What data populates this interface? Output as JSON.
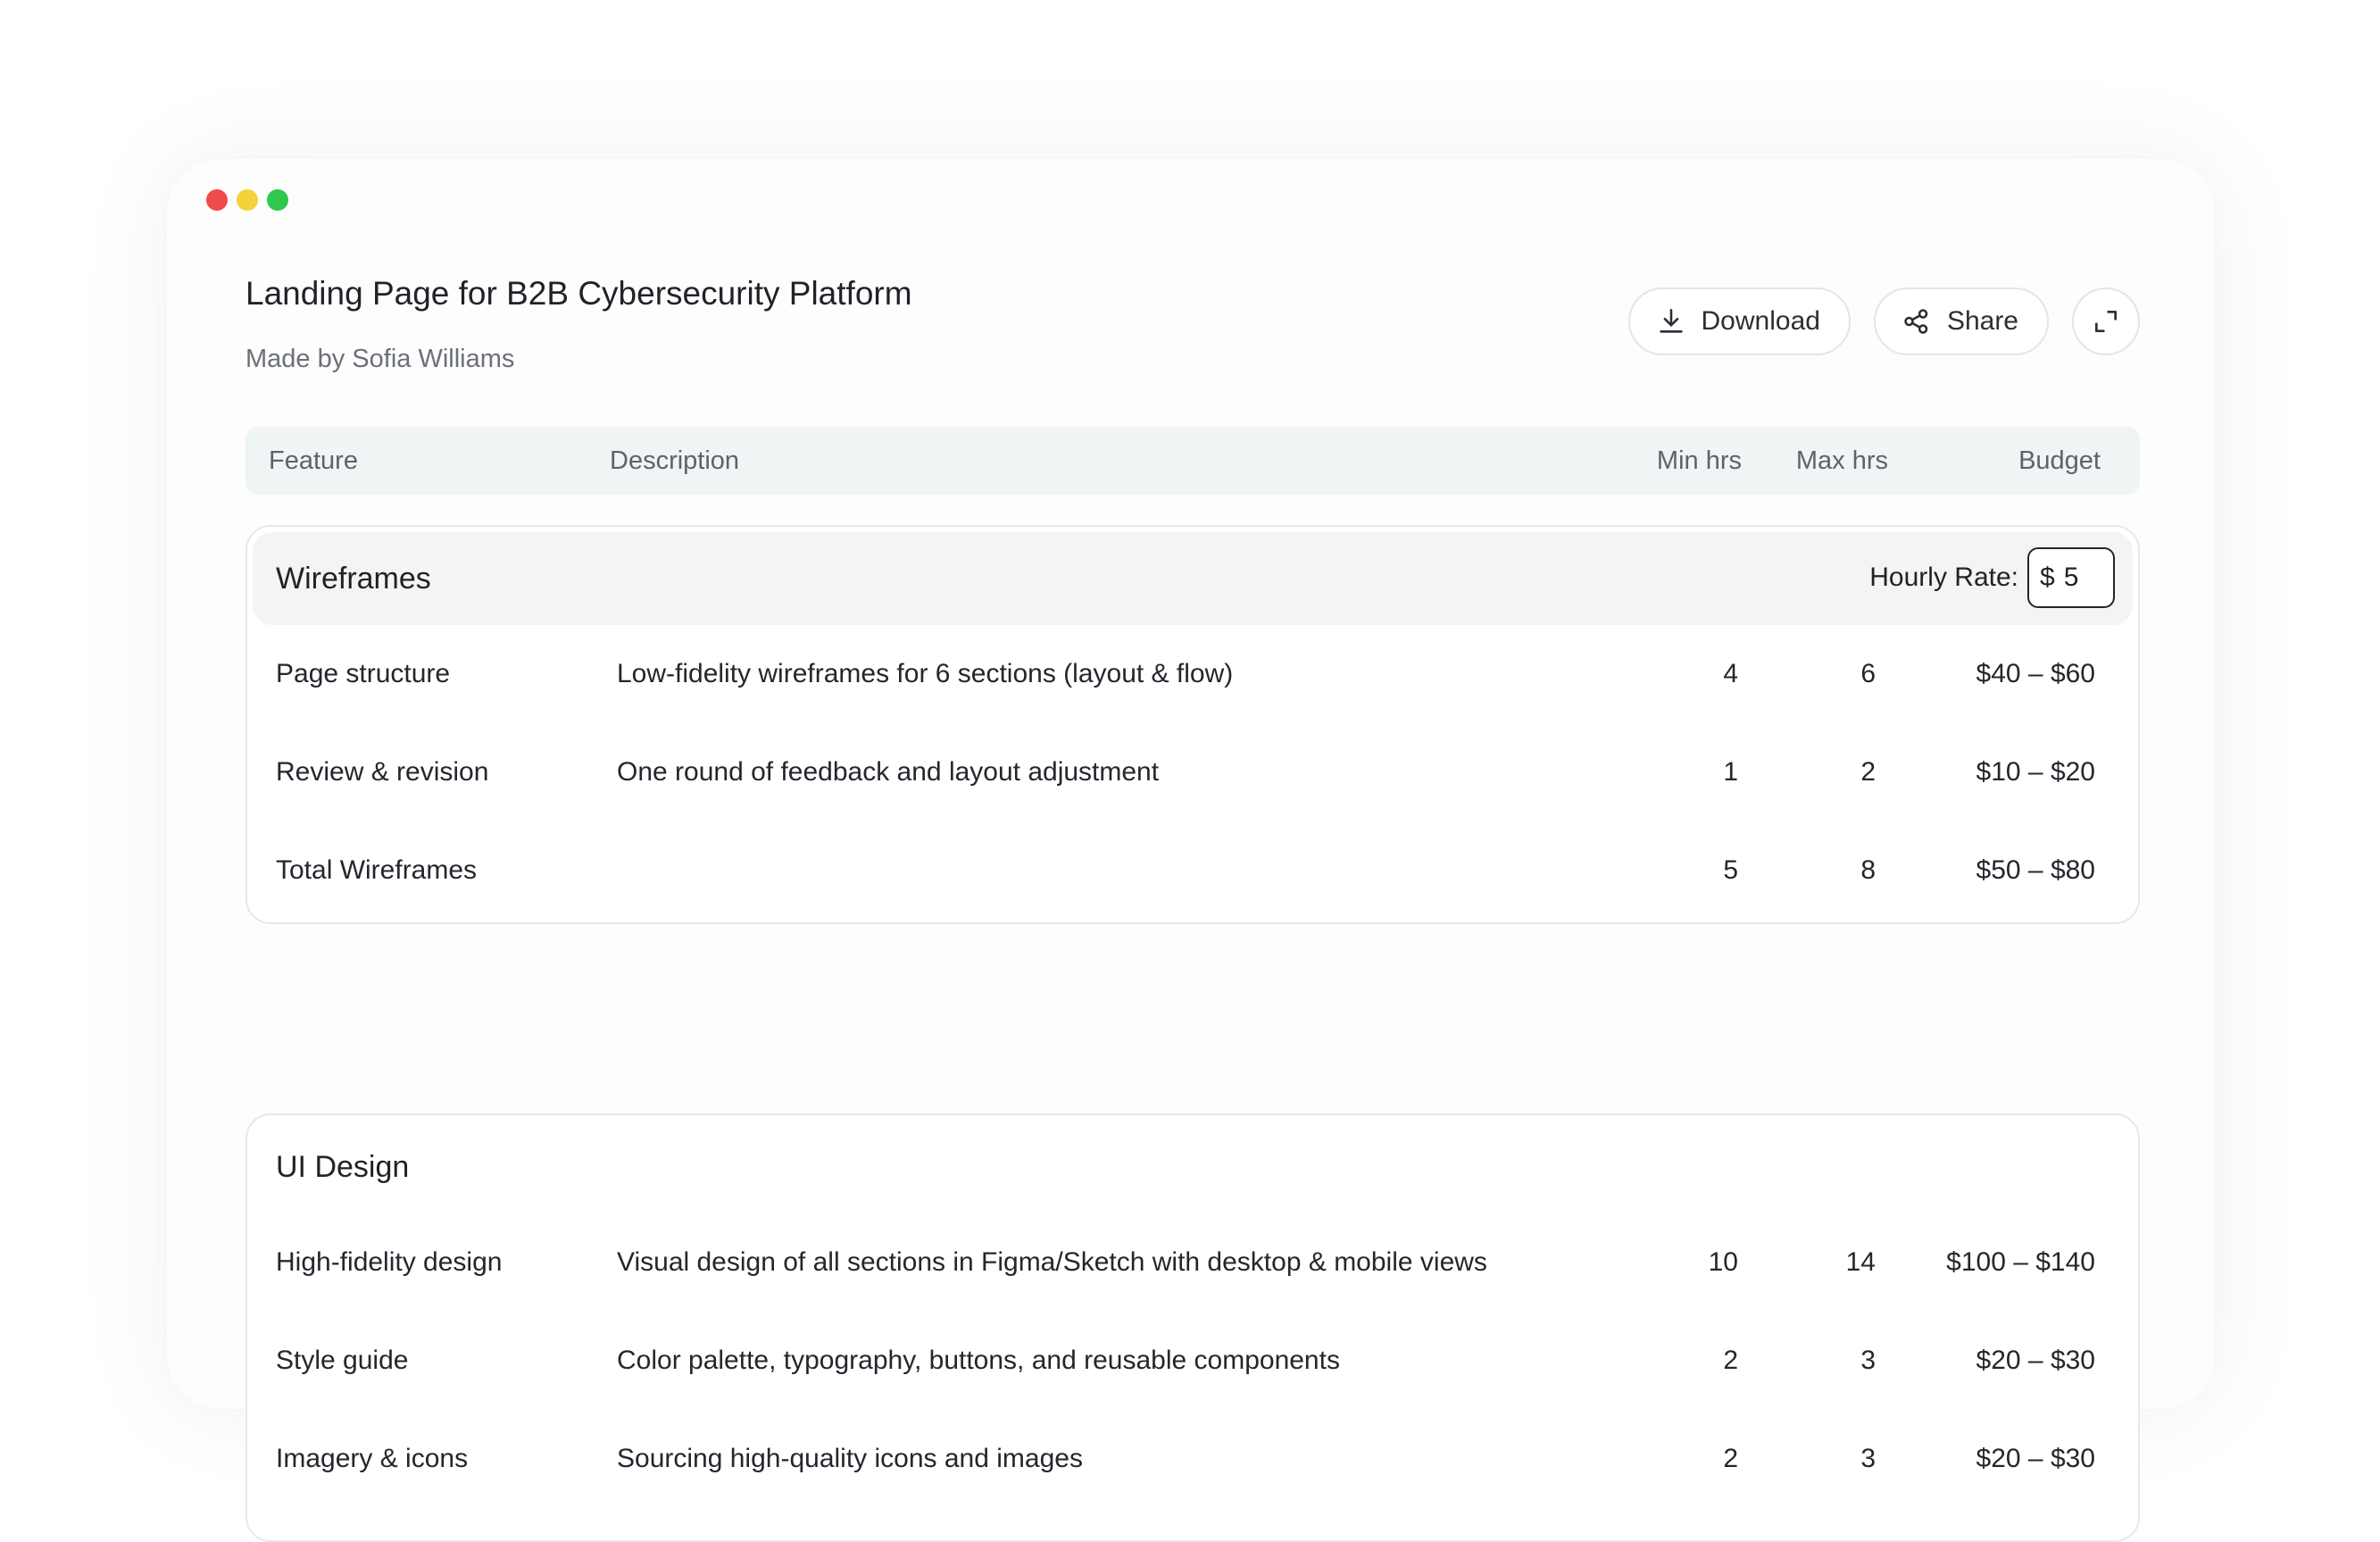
{
  "window": {
    "title": "Landing Page for B2B Cybersecurity Platform",
    "subtitle": "Made by Sofia Williams"
  },
  "actions": {
    "download_label": "Download",
    "share_label": "Share",
    "icons": [
      "download-icon",
      "share-icon",
      "expand-icon"
    ]
  },
  "table": {
    "headers": {
      "feature": "Feature",
      "description": "Description",
      "min": "Min hrs",
      "max": "Max hrs",
      "budget": "Budget"
    }
  },
  "groups": [
    {
      "name": "Wireframes",
      "rate_label": "Hourly Rate:",
      "rate_currency": "$",
      "rate_value": "5",
      "rows": [
        {
          "feature": "Page structure",
          "description": "Low-fidelity wireframes for 6 sections (layout & flow)",
          "min": "4",
          "max": "6",
          "budget": "$40 – $60"
        },
        {
          "feature": "Review & revision",
          "description": "One round of feedback and layout adjustment",
          "min": "1",
          "max": "2",
          "budget": "$10 – $20"
        }
      ],
      "total": {
        "feature": "Total Wireframes",
        "min": "5",
        "max": "8",
        "budget": "$50 – $80"
      }
    },
    {
      "name": "UI Design",
      "rows": [
        {
          "feature": "High-fidelity design",
          "description": "Visual design of all sections in Figma/Sketch with desktop & mobile views",
          "min": "10",
          "max": "14",
          "budget": "$100 – $140"
        },
        {
          "feature": "Style guide",
          "description": "Color palette, typography, buttons, and reusable components",
          "min": "2",
          "max": "3",
          "budget": "$20 – $30"
        },
        {
          "feature": "Imagery & icons",
          "description": "Sourcing high-quality icons and images",
          "min": "2",
          "max": "3",
          "budget": "$20 – $30"
        }
      ]
    }
  ],
  "colors": {
    "close": "#f04b4b",
    "minimize": "#f3d23a",
    "maximize": "#2fc84e",
    "header_bg": "#eff4f4",
    "group_head_bg": "#f5f3f3"
  }
}
